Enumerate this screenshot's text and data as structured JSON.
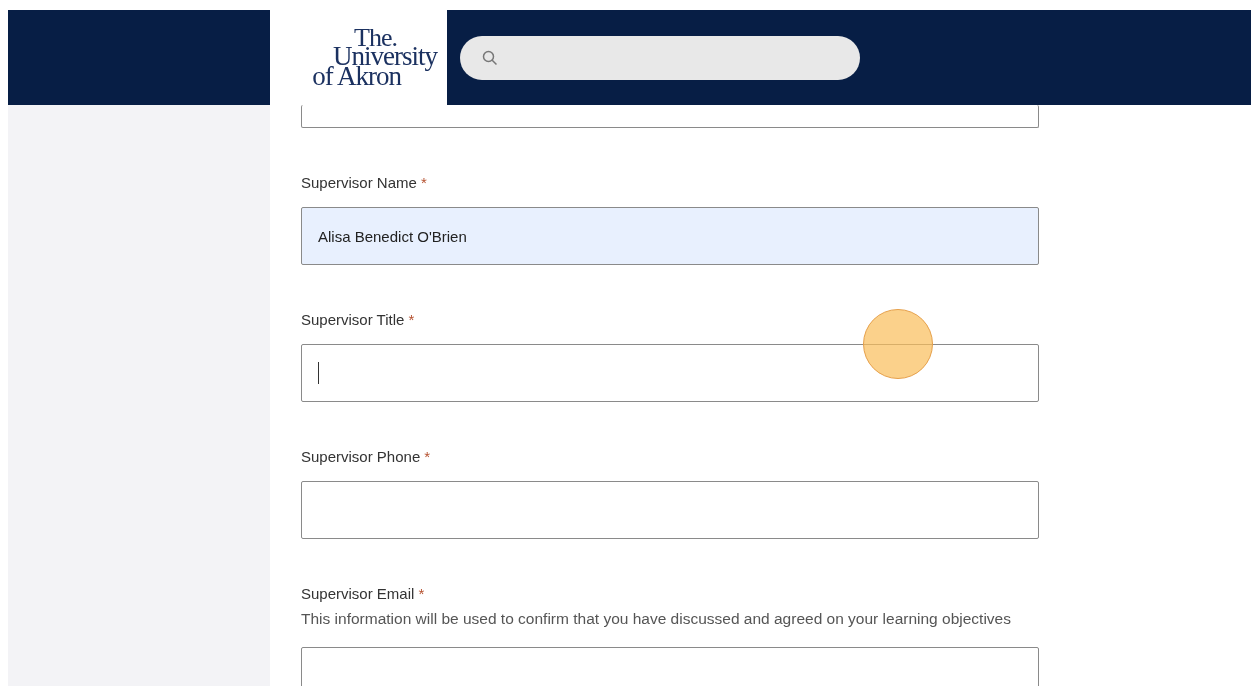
{
  "header": {
    "logo": {
      "lines": [
        "The.",
        "University",
        "of Akron"
      ]
    }
  },
  "form": {
    "fields": [
      {
        "kind": "clipped",
        "autofilled": false,
        "focused": false
      },
      {
        "kind": "text",
        "label": "Supervisor Name",
        "required_mark": "*",
        "value": "Alisa Benedict O'Brien",
        "autofilled": true,
        "focused": false
      },
      {
        "kind": "text",
        "label": "Supervisor Title",
        "required_mark": "*",
        "autofilled": false,
        "focused": true
      },
      {
        "kind": "text",
        "label": "Supervisor Phone",
        "required_mark": "*",
        "autofilled": false,
        "focused": false
      },
      {
        "kind": "text",
        "label": "Supervisor Email",
        "required_mark": "*",
        "description": "This information will be used to confirm that you have discussed and agreed on your learning objectives",
        "autofilled": false,
        "focused": false
      }
    ]
  }
}
